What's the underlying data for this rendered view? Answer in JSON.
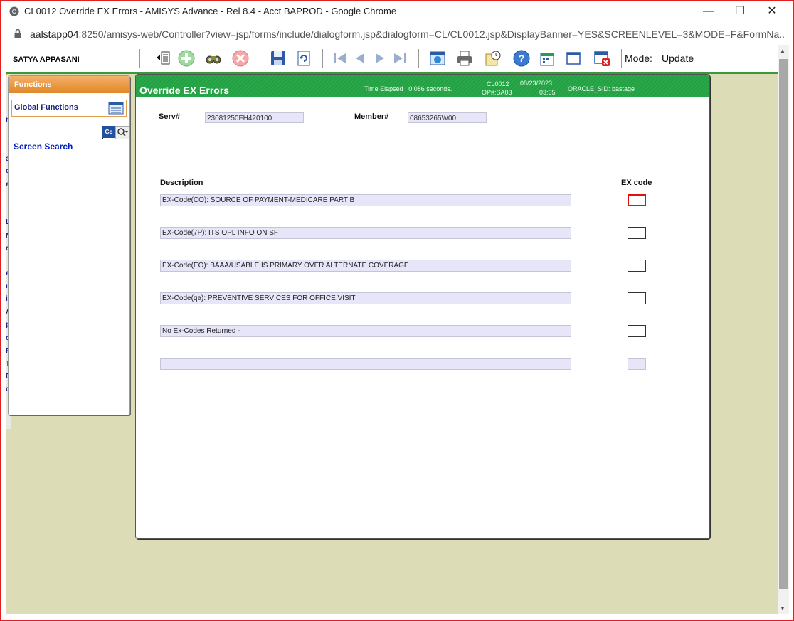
{
  "browser": {
    "title": "CL0012 Override EX Errors - AMISYS Advance - Rel 8.4 - Acct BAPROD - Google Chrome",
    "url_host": "aalstapp04",
    "url_rest": ":8250/amisys-web/Controller?view=jsp/forms/include/dialogform.jsp&dialogform=CL/CL0012.jsp&DisplayBanner=YES&SCREENLEVEL=3&MODE=F&FormNa..."
  },
  "toolbar": {
    "user": "SATYA APPASANI",
    "mode_label": "Mode:",
    "mode_value": "Update"
  },
  "functions": {
    "header": "Functions",
    "global_functions": "Global Functions",
    "go_label": "Go",
    "screen_search": "Screen Search"
  },
  "form": {
    "title": "Override EX Errors",
    "elapsed": "Time Elapsed : 0.086 seconds.",
    "screen_code": "CL0012",
    "op_code": "OP#:SA03",
    "date": "08/23/2023",
    "time": "03:05",
    "oracle_sid": "ORACLE_SID: bastage",
    "serv_label": "Serv#",
    "serv_value": "23081250FH420100",
    "member_label": "Member#",
    "member_value": "08653265W00",
    "desc_header": "Description",
    "excode_header": "EX code",
    "rows": [
      {
        "description": "EX-Code(CO): SOURCE OF PAYMENT-MEDICARE PART B",
        "excode": ""
      },
      {
        "description": "EX-Code(7P): ITS OPL INFO ON SF",
        "excode": ""
      },
      {
        "description": "EX-Code(EO): BAAA/USABLE IS PRIMARY OVER ALTERNATE COVERAGE",
        "excode": ""
      },
      {
        "description": "EX-Code(qa): PREVENTIVE SERVICES FOR OFFICE VISIT",
        "excode": ""
      },
      {
        "description": "No Ex-Codes Returned -",
        "excode": ""
      },
      {
        "description": "",
        "excode": ""
      }
    ]
  },
  "background_fragments": [
    "P",
    "S",
    "e",
    "no",
    "ai",
    "ca",
    "et",
    "L",
    "M",
    "de",
    "e",
    "n",
    "ic",
    "A",
    "p",
    "o",
    "P",
    "TI",
    "D",
    "dj"
  ]
}
